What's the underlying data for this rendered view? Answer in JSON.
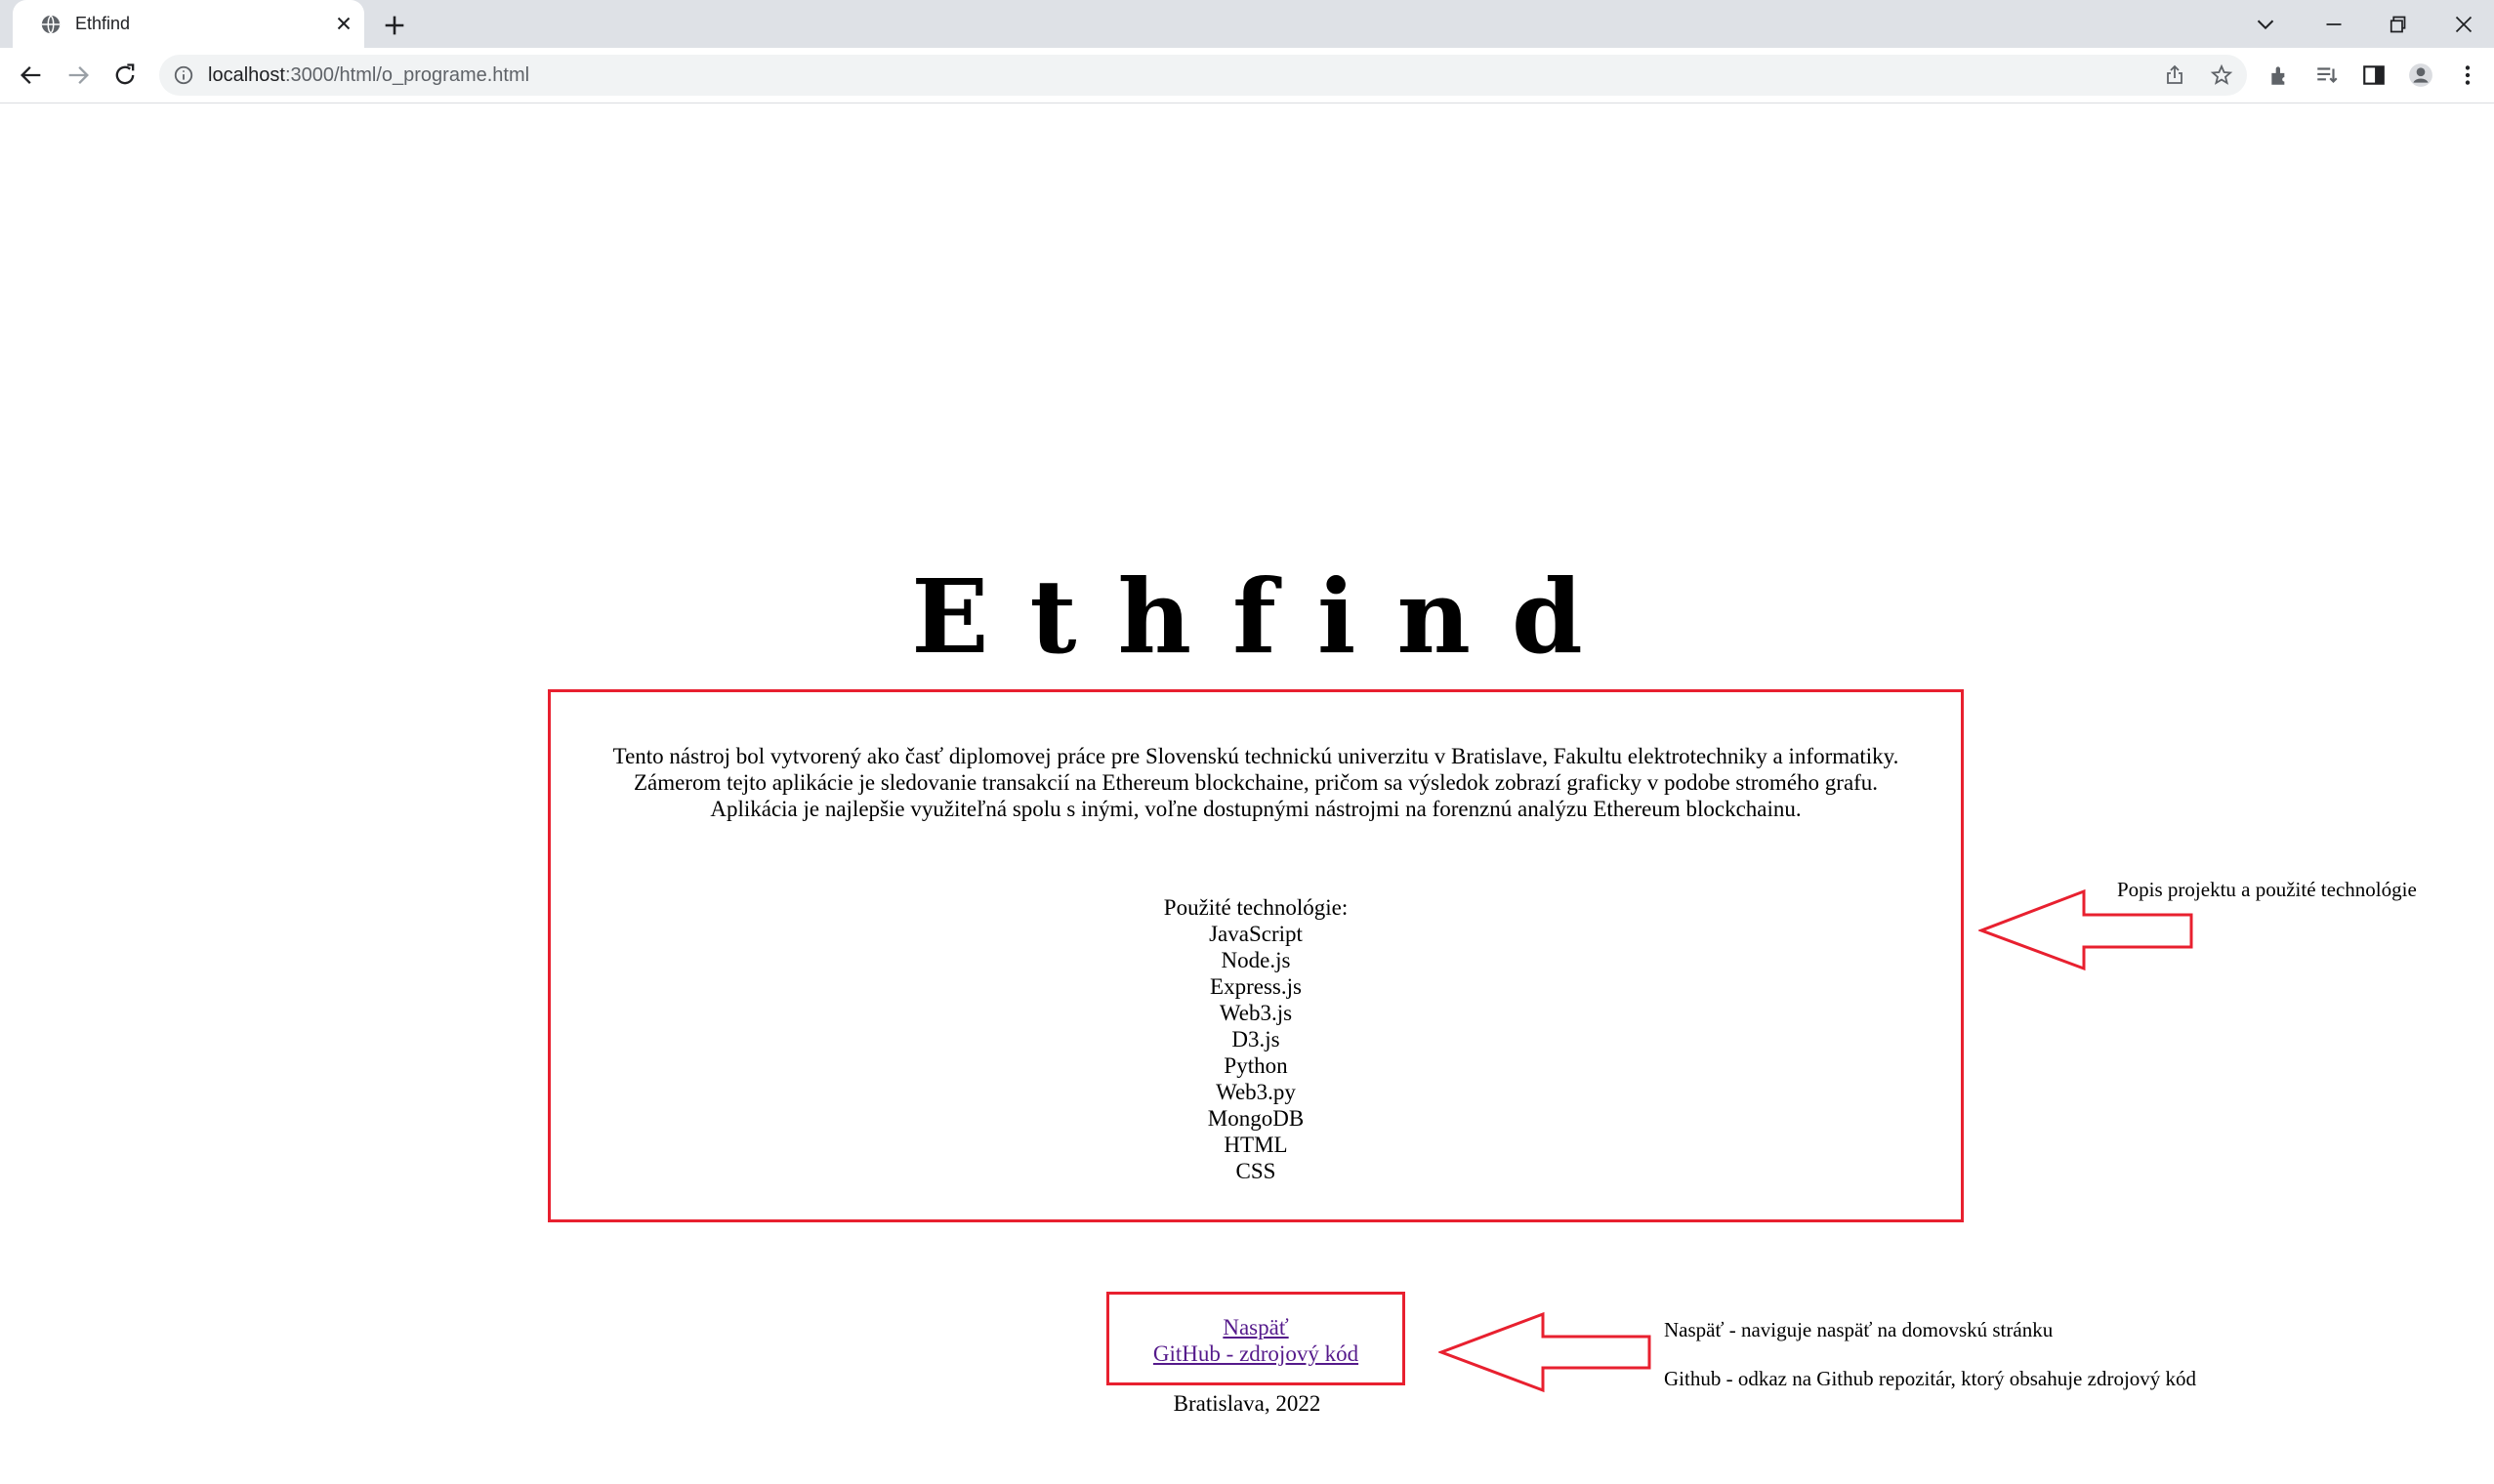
{
  "browser": {
    "tab_title": "Ethfind",
    "url_host": "localhost",
    "url_rest": ":3000/html/o_programe.html"
  },
  "page": {
    "title": "Ethfind",
    "description": [
      "Tento nástroj bol vytvorený ako časť diplomovej práce pre Slovenskú technickú univerzitu v Bratislave, Fakultu elektrotechniky a informatiky.",
      "Zámerom tejto aplikácie je sledovanie transakcií na Ethereum blockchaine, pričom sa výsledok zobrazí graficky v podobe stromého grafu.",
      "Aplikácia je najlepšie využiteľná spolu s inými, voľne dostupnými nástrojmi na forenznú analýzu Ethereum blockchainu."
    ],
    "tech_heading": "Použité technológie:",
    "technologies": [
      "JavaScript",
      "Node.js",
      "Express.js",
      "Web3.js",
      "D3.js",
      "Python",
      "Web3.py",
      "MongoDB",
      "HTML",
      "CSS"
    ],
    "links": {
      "back": "Naspäť",
      "github": "GitHub - zdrojový kód"
    },
    "footer": "Bratislava, 2022"
  },
  "annotations": {
    "description_note": "Popis projektu a použité technológie",
    "back_note": "Naspäť - naviguje naspäť na domovskú stránku",
    "github_note": "Github - odkaz na Github repozitár, ktorý obsahuje zdrojový kód"
  },
  "colors": {
    "highlight": "#e8202f",
    "link_visited": "#551a8b",
    "chrome_bg": "#dee1e6"
  },
  "icons": [
    "globe-icon",
    "close-icon",
    "plus-icon",
    "chevron-down-icon",
    "minimize-icon",
    "restore-icon",
    "window-close-icon",
    "back-arrow-icon",
    "forward-arrow-icon",
    "reload-icon",
    "info-icon",
    "share-icon",
    "star-icon",
    "extensions-icon",
    "reading-list-icon",
    "side-panel-icon",
    "profile-icon",
    "menu-icon"
  ]
}
